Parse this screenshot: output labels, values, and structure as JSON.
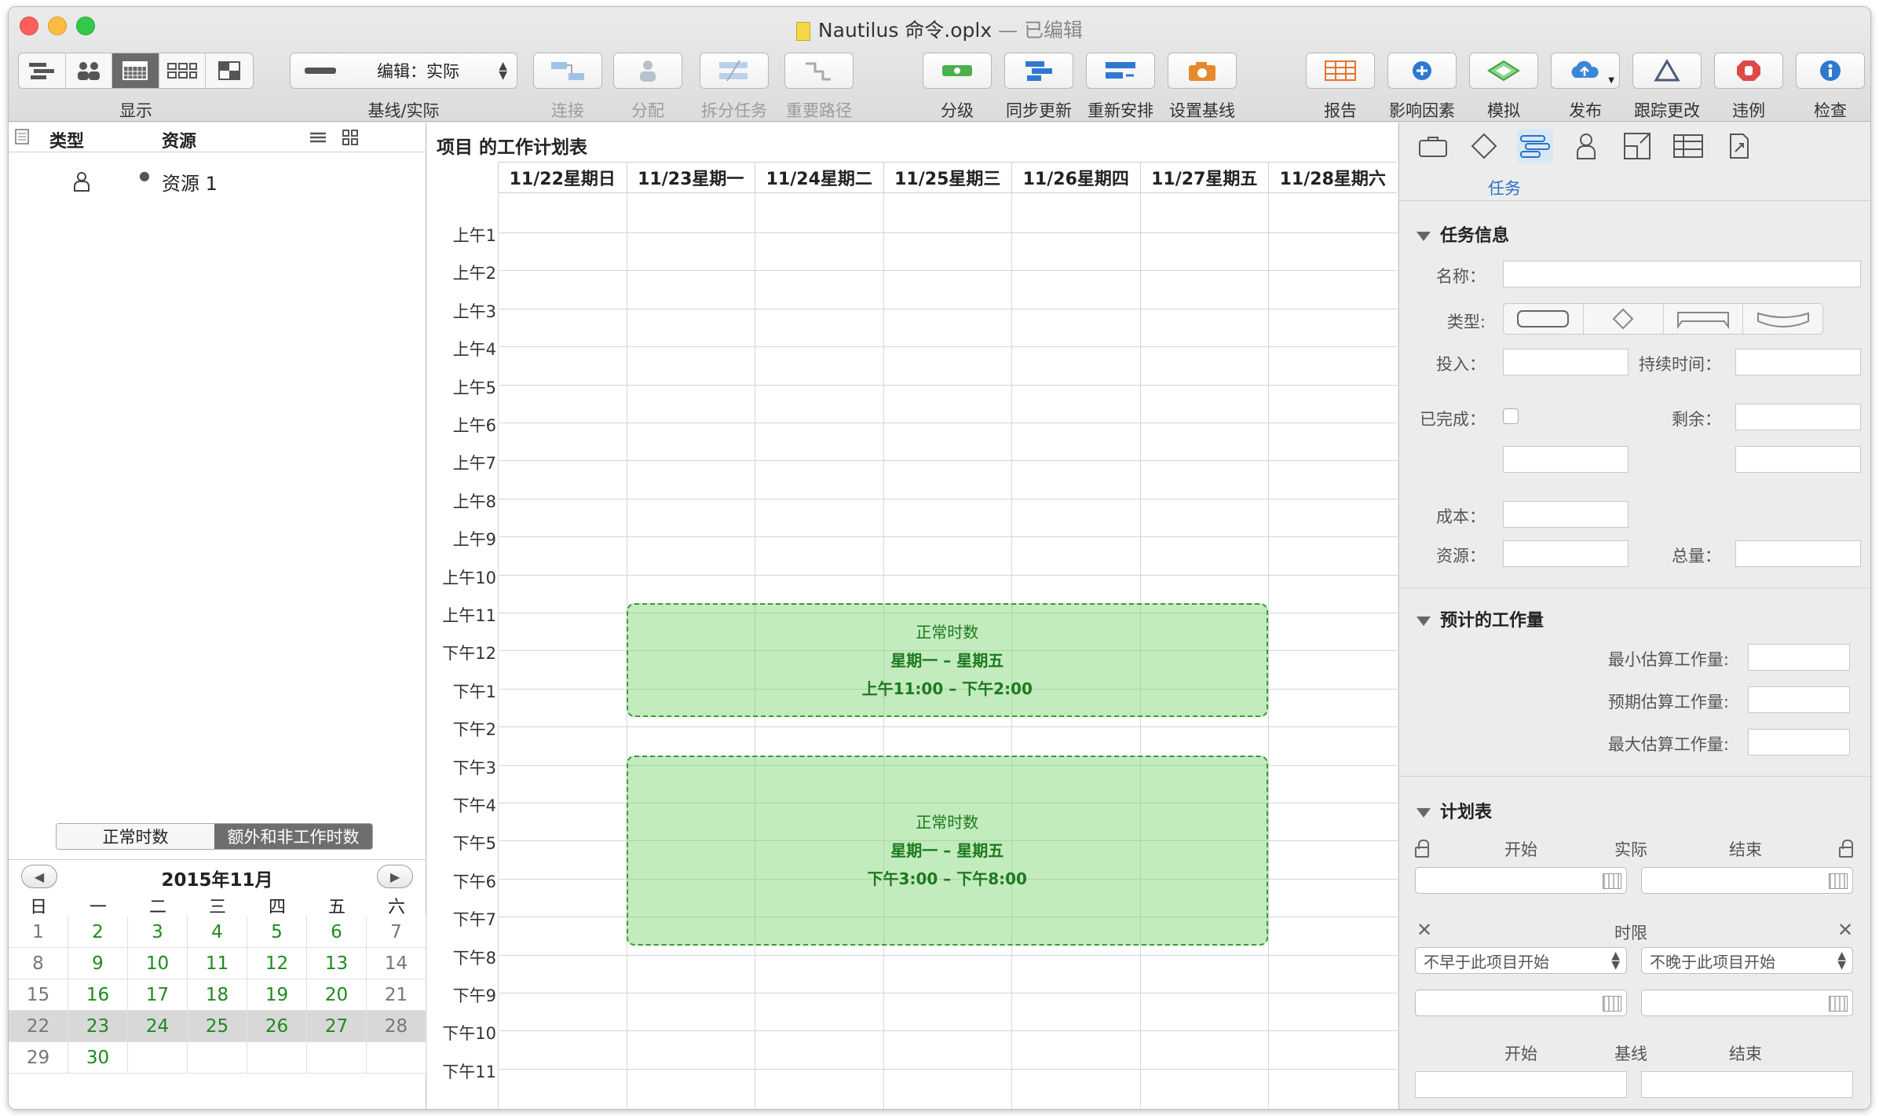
{
  "window": {
    "title": "Nautilus 命令.oplx",
    "edited": " — 已编辑"
  },
  "toolbar": {
    "view_label": "显示",
    "baseline_select": "编辑：实际",
    "baseline_label": "基线/实际",
    "connect": "连接",
    "assign": "分配",
    "split": "拆分任务",
    "critical": "重要路径",
    "level": "分级",
    "catch_up": "同步更新",
    "reschedule": "重新安排",
    "set_baseline": "设置基线",
    "report": "报告",
    "influence": "影响因素",
    "simulate": "模拟",
    "publish": "发布",
    "track": "跟踪更改",
    "violations": "违例",
    "inspect": "检查"
  },
  "left": {
    "col_type": "类型",
    "col_resource": "资源",
    "resource_name": "资源 1",
    "tab_normal": "正常时数",
    "tab_extra": "额外和非工作时数"
  },
  "calendar": {
    "month": "2015年11月",
    "weekdays": [
      "日",
      "一",
      "二",
      "三",
      "四",
      "五",
      "六"
    ],
    "weeks": [
      [
        "1",
        "2",
        "3",
        "4",
        "5",
        "6",
        "7"
      ],
      [
        "8",
        "9",
        "10",
        "11",
        "12",
        "13",
        "14"
      ],
      [
        "15",
        "16",
        "17",
        "18",
        "19",
        "20",
        "21"
      ],
      [
        "22",
        "23",
        "24",
        "25",
        "26",
        "27",
        "28"
      ],
      [
        "29",
        "30",
        "",
        "",
        "",
        "",
        ""
      ]
    ]
  },
  "schedule": {
    "title": "项目 的工作计划表",
    "days": [
      "11/22星期日",
      "11/23星期一",
      "11/24星期二",
      "11/25星期三",
      "11/26星期四",
      "11/27星期五",
      "11/28星期六"
    ],
    "hours": [
      "上午1",
      "上午2",
      "上午3",
      "上午4",
      "上午5",
      "上午6",
      "上午7",
      "上午8",
      "上午9",
      "上午10",
      "上午11",
      "下午12",
      "下午1",
      "下午2",
      "下午3",
      "下午4",
      "下午5",
      "下午6",
      "下午7",
      "下午8",
      "下午9",
      "下午10",
      "下午11"
    ],
    "blocks": [
      {
        "title": "正常时数",
        "days": "星期一 – 星期五",
        "time": "上午11:00 – 下午2:00"
      },
      {
        "title": "正常时数",
        "days": "星期一 – 星期五",
        "time": "下午3:00 – 下午8:00"
      }
    ]
  },
  "inspector": {
    "tab_label": "任务",
    "task_info": "任务信息",
    "name": "名称：",
    "type": "类型:",
    "effort": "投入：",
    "duration": "持续时间：",
    "completed": "已完成：",
    "remaining": "剩余：",
    "cost": "成本：",
    "resources": "资源：",
    "total": "总量：",
    "estimate_section": "预计的工作量",
    "min_est": "最小估算工作量:",
    "exp_est": "预期估算工作量:",
    "max_est": "最大估算工作量:",
    "schedule_section": "计划表",
    "start": "开始",
    "actual": "实际",
    "end": "结束",
    "limits": "时限",
    "not_before": "不早于此项目开始",
    "not_after": "不晚于此项目开始",
    "start2": "开始",
    "baseline": "基线",
    "end2": "结束"
  }
}
